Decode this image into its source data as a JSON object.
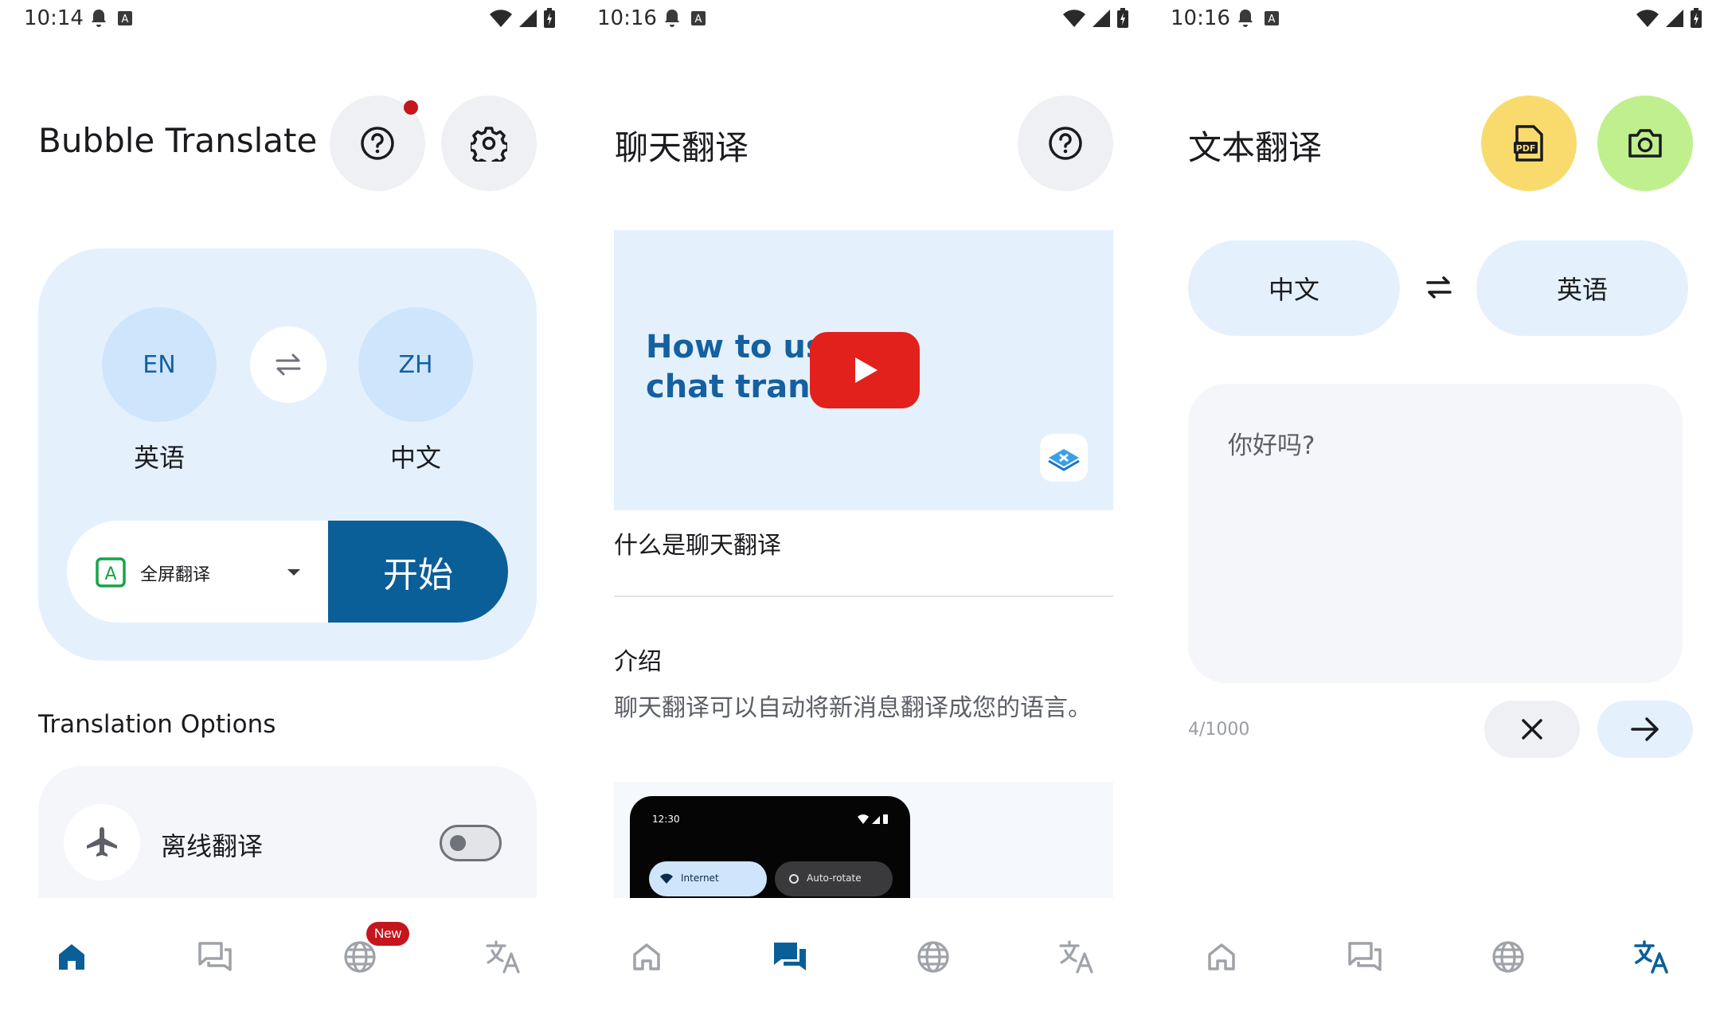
{
  "colors": {
    "accent": "#0a5f98",
    "card_blue": "#e4f1fd",
    "lang_circle": "#cfe5fb",
    "badge_red": "#c4161c",
    "pdf_yellow": "#f9db6d",
    "camera_green": "#c0ef8e"
  },
  "screens": [
    {
      "status": {
        "time": "10:14"
      },
      "header": {
        "title": "Bubble Translate",
        "help_icon": "help-circle-icon",
        "settings_icon": "gear-icon"
      },
      "source_lang": {
        "code": "EN",
        "name": "英语"
      },
      "target_lang": {
        "code": "ZH",
        "name": "中文"
      },
      "mode": {
        "icon": "auto-translate-icon",
        "label": "全屏翻译"
      },
      "start_label": "开始",
      "section_title": "Translation Options",
      "options": [
        {
          "icon": "airplane-icon",
          "label": "离线翻译",
          "enabled": false
        }
      ],
      "nav": {
        "active": "home",
        "badge": "New"
      }
    },
    {
      "status": {
        "time": "10:16"
      },
      "header": {
        "title": "聊天翻译",
        "help_icon": "help-circle-icon"
      },
      "video": {
        "caption_line1": "How to us",
        "caption_line2": "chat trans"
      },
      "question": "什么是聊天翻译",
      "intro_title": "介绍",
      "intro_text": "聊天翻译可以自动将新消息翻译成您的语言。",
      "demo": {
        "time": "12:30",
        "tile1": "Internet",
        "tile2": "Auto-rotate"
      },
      "nav": {
        "active": "chat"
      }
    },
    {
      "status": {
        "time": "10:16"
      },
      "header": {
        "title": "文本翻译",
        "pdf_icon": "pdf-icon",
        "camera_icon": "camera-icon"
      },
      "source_lang": "中文",
      "target_lang": "英语",
      "input_text": "你好吗?",
      "char_count": "4/1000",
      "nav": {
        "active": "translate"
      }
    }
  ]
}
